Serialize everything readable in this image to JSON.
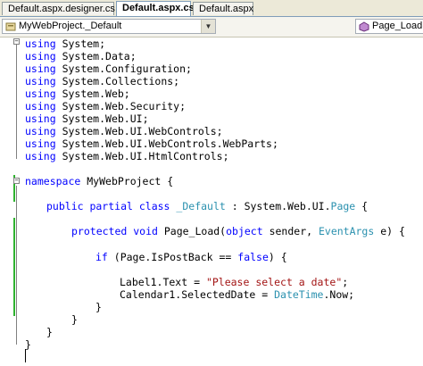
{
  "tabs": [
    {
      "label": "Default.aspx.designer.cs",
      "active": false
    },
    {
      "label": "Default.aspx.cs",
      "active": true
    },
    {
      "label": "Default.aspx",
      "active": false
    }
  ],
  "navbar": {
    "type_combo": "MyWebProject._Default",
    "member_combo": "Page_Load(object"
  },
  "code": {
    "usings": [
      "using System;",
      "using System.Data;",
      "using System.Configuration;",
      "using System.Collections;",
      "using System.Web;",
      "using System.Web.Security;",
      "using System.Web.UI;",
      "using System.Web.UI.WebControls;",
      "using System.Web.UI.WebControls.WebParts;",
      "using System.Web.UI.HtmlControls;"
    ],
    "namespace_line": "namespace MyWebProject {",
    "class_line": {
      "kw": "public partial class",
      "name": "_Default",
      "rest": " : System.Web.UI.",
      "base": "Page",
      "end": " {"
    },
    "method_line": {
      "kw": "protected void",
      "name": " Page_Load(",
      "kw2": "object",
      "arg1": " sender, ",
      "type": "EventArgs",
      "end": " e) {"
    },
    "if_line": {
      "kw": "if",
      "mid": " (Page.IsPostBack == ",
      "kw2": "false",
      "end": ") {"
    },
    "label_line": {
      "start": "Label1.Text = ",
      "string": "\"Please select a date\"",
      "end": ";"
    },
    "calendar_line": {
      "start": "Calendar1.SelectedDate = ",
      "type": "DateTime",
      "end": ".Now;"
    },
    "close_if": "}",
    "close_method": "}",
    "close_class": "}",
    "close_namespace": "}"
  },
  "colors": {
    "keyword": "#0000ff",
    "type": "#2b91af",
    "string": "#a31515",
    "changed_marker": "#2fb32f"
  },
  "icons": [
    "class-icon",
    "method-icon",
    "collapse-icon"
  ]
}
